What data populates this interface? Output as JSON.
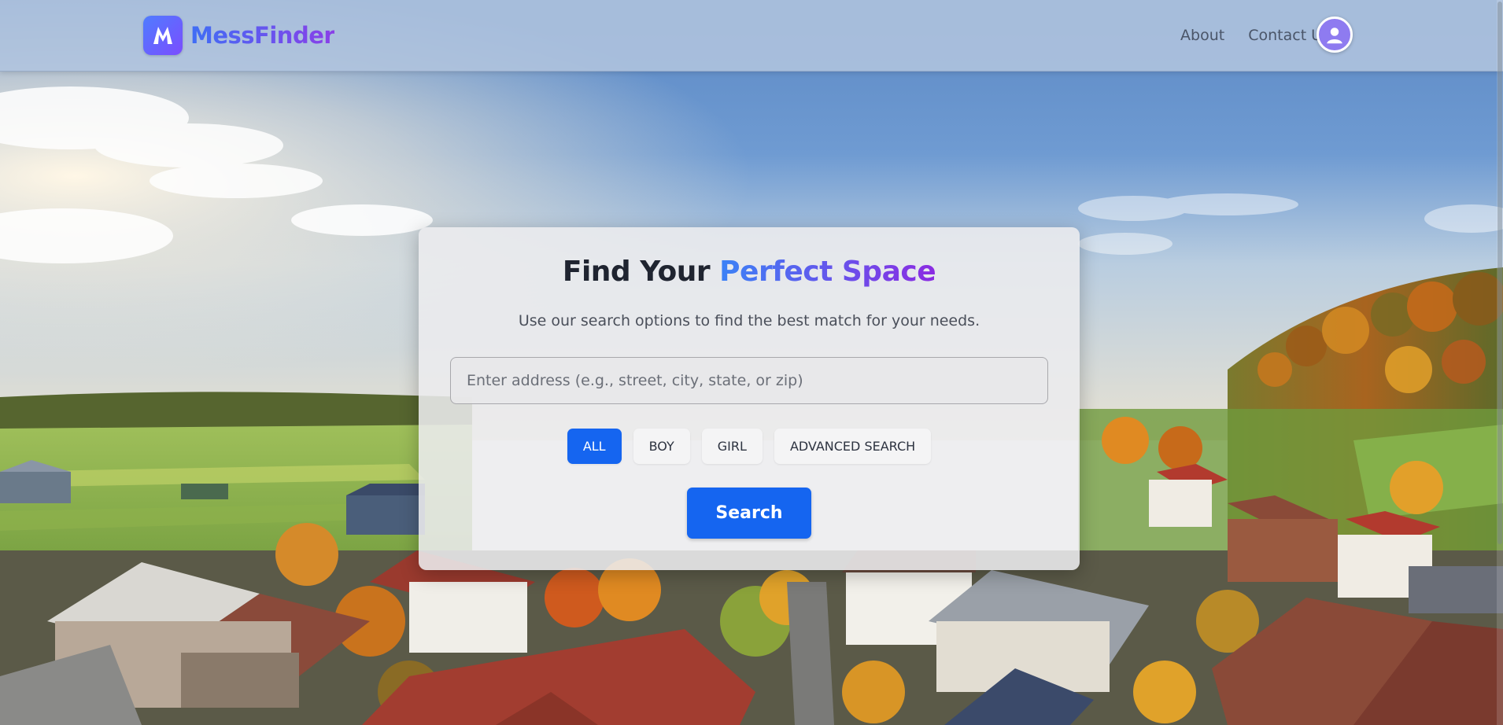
{
  "brand": {
    "name": "MessFinder",
    "logo_letter": "M",
    "gradient_start": "#4f7cff",
    "gradient_end": "#8a3fe8"
  },
  "nav": {
    "links": [
      {
        "label": "About"
      },
      {
        "label": "Contact Us"
      }
    ],
    "avatar_icon": "user-icon"
  },
  "hero": {
    "title_prefix": "Find Your ",
    "title_accent": "Perfect Space",
    "subtitle": "Use our search options to find the best match for your needs.",
    "search": {
      "placeholder": "Enter address (e.g., street, city, state, or zip)",
      "value": ""
    },
    "filters": [
      {
        "label": "ALL",
        "active": true
      },
      {
        "label": "BOY",
        "active": false
      },
      {
        "label": "GIRL",
        "active": false
      },
      {
        "label": "ADVANCED SEARCH",
        "active": false
      }
    ],
    "search_button_label": "Search"
  },
  "colors": {
    "primary": "#1565f0",
    "navbar": "#b0c4de",
    "title_text": "#1f2430"
  }
}
